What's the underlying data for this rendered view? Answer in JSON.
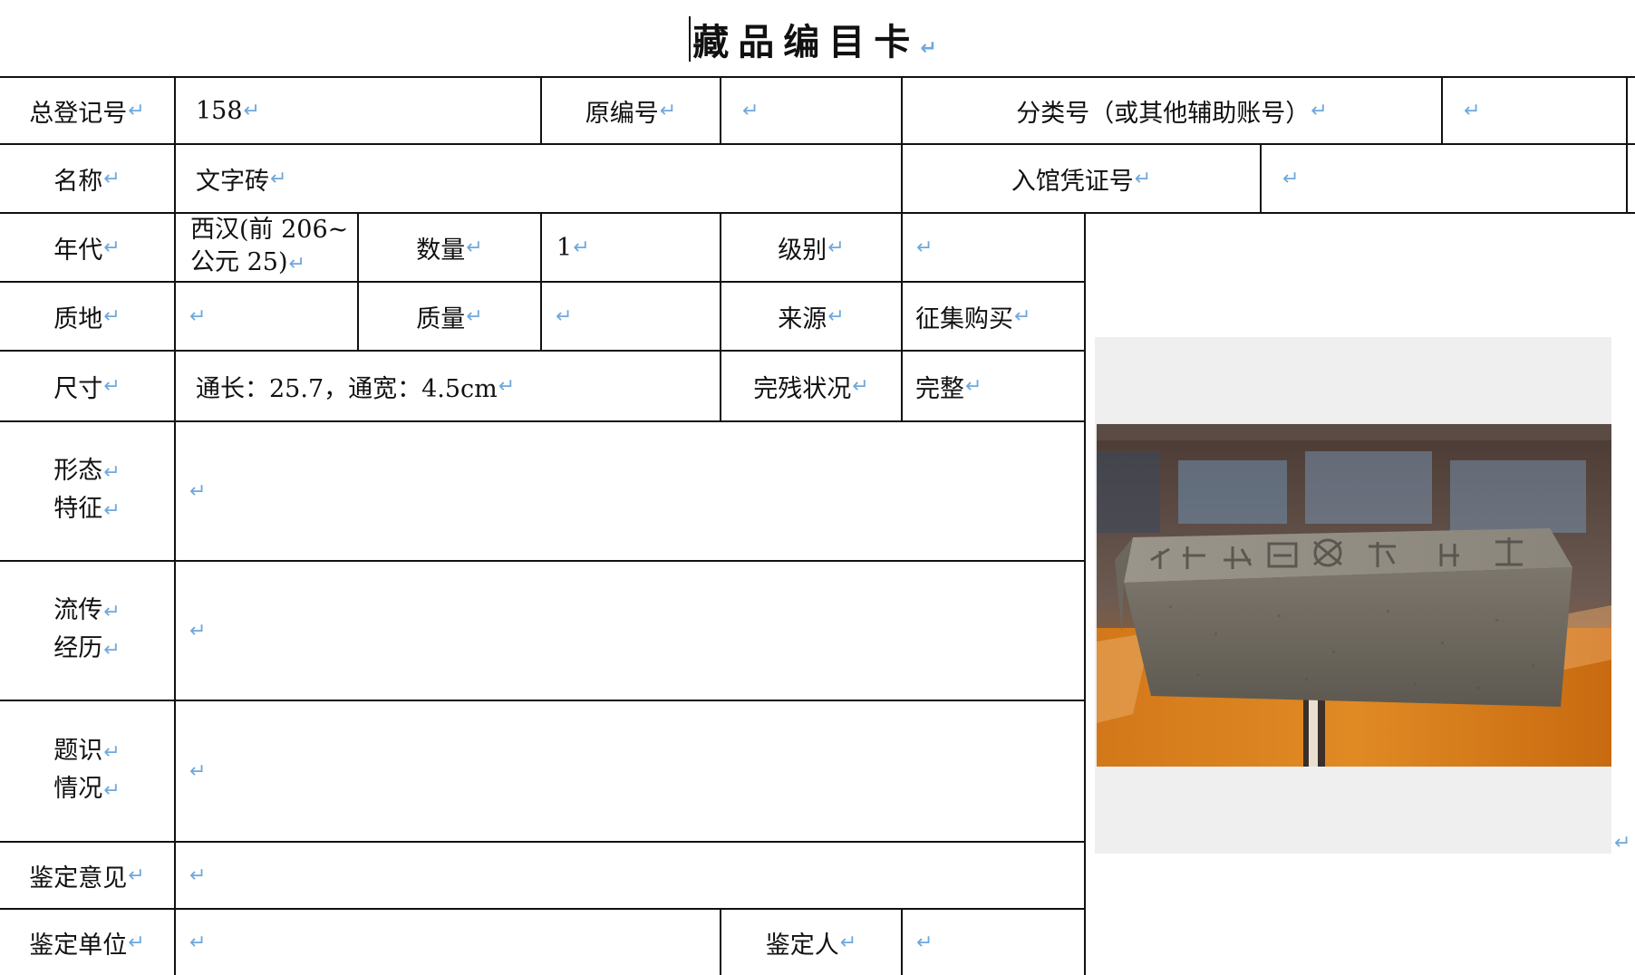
{
  "title": "藏品编目卡",
  "return_mark": "↵",
  "fields": {
    "registration_no": {
      "label": "总登记号",
      "value": "158"
    },
    "original_no": {
      "label": "原编号",
      "value": ""
    },
    "classification_no": {
      "label": "分类号（或其他辅助账号）",
      "value": ""
    },
    "name": {
      "label": "名称",
      "value": "文字砖"
    },
    "entry_voucher_no": {
      "label": "入馆凭证号",
      "value": ""
    },
    "era": {
      "label": "年代",
      "value_line1": "西汉(前 206~",
      "value_line2": "公元 25)"
    },
    "quantity": {
      "label": "数量",
      "value": "1"
    },
    "grade": {
      "label": "级别",
      "value": ""
    },
    "material": {
      "label": "质地",
      "value": ""
    },
    "weight": {
      "label": "质量",
      "value": ""
    },
    "source": {
      "label": "来源",
      "value": "征集购买"
    },
    "dimensions": {
      "label": "尺寸",
      "value": "通长：25.7，通宽：4.5cm"
    },
    "condition": {
      "label": "完残状况",
      "value": "完整"
    },
    "morphology": {
      "label_line1": "形态",
      "label_line2": "特征",
      "value": ""
    },
    "provenance": {
      "label_line1": "流传",
      "label_line2": "经历",
      "value": ""
    },
    "inscription": {
      "label_line1": "题识",
      "label_line2": "情况",
      "value": ""
    },
    "appraisal_opinion": {
      "label": "鉴定意见",
      "value": ""
    },
    "appraisal_unit": {
      "label": "鉴定单位",
      "value": ""
    },
    "appraiser": {
      "label": "鉴定人",
      "value": ""
    }
  },
  "colors": {
    "grid": "#111111",
    "return_mark": "#6fa8dc",
    "photo_background": "#efefef"
  }
}
